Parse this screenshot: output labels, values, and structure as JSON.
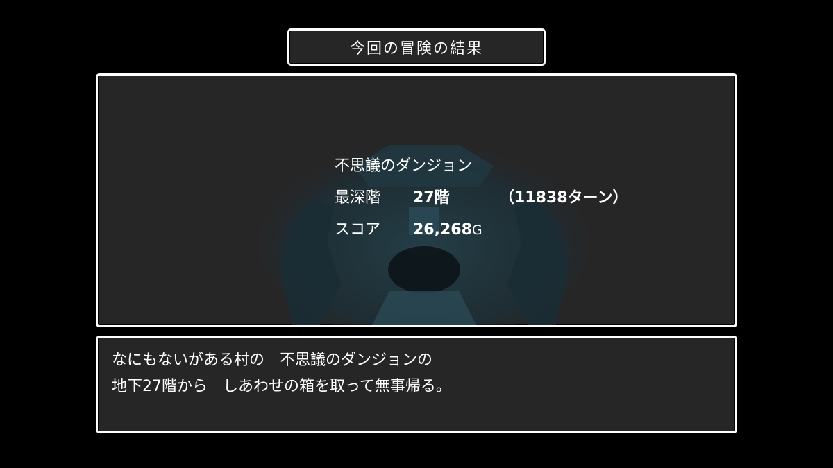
{
  "title": "今回の冒険の結果",
  "result": {
    "dungeon_name": "不思議のダンジョン",
    "depth_label": "最深階",
    "depth_value": "27階",
    "turns": "（11838ターン）",
    "score_label": "スコア",
    "score_value": "26,268",
    "score_unit": "G"
  },
  "message": {
    "line1": "なにもないがある村の　不思議のダンジョンの",
    "line2": "地下27階から　しあわせの箱を取って無事帰る。"
  },
  "colors": {
    "background": "#000000",
    "window_fill": "#262626",
    "window_border": "#ffffff",
    "text": "#ffffff",
    "cave_art": "#1f3640"
  }
}
